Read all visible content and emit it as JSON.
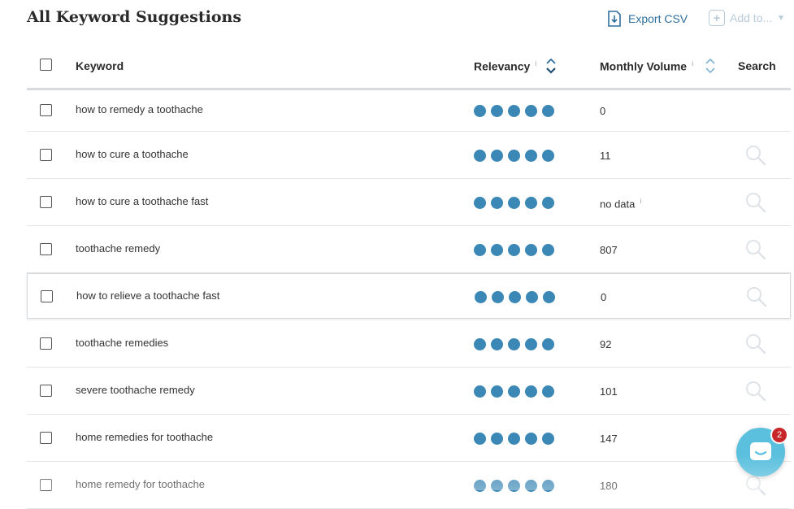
{
  "page": {
    "title": "All Keyword Suggestions",
    "export_label": "Export CSV",
    "add_to_label": "Add to..."
  },
  "table": {
    "headers": {
      "keyword": "Keyword",
      "relevancy": "Relevancy",
      "monthly_volume": "Monthly Volume",
      "search": "Search",
      "info": "i"
    },
    "rows": [
      {
        "keyword": "how to remedy a toothache",
        "relevancy": 5,
        "volume": "0"
      },
      {
        "keyword": "how to cure a toothache",
        "relevancy": 5,
        "volume": "11"
      },
      {
        "keyword": "how to cure a toothache fast",
        "relevancy": 5,
        "volume": "no data"
      },
      {
        "keyword": "toothache remedy",
        "relevancy": 5,
        "volume": "807"
      },
      {
        "keyword": "how to relieve a toothache fast",
        "relevancy": 5,
        "volume": "0"
      },
      {
        "keyword": "toothache remedies",
        "relevancy": 5,
        "volume": "92"
      },
      {
        "keyword": "severe toothache remedy",
        "relevancy": 5,
        "volume": "101"
      },
      {
        "keyword": "home remedies for toothache",
        "relevancy": 5,
        "volume": "147"
      },
      {
        "keyword": "home remedy for toothache",
        "relevancy": 5,
        "volume": "180"
      }
    ]
  },
  "chat": {
    "unread_count": "2"
  },
  "colors": {
    "accent": "#3b87b5",
    "link": "#2e6f9e",
    "disabled": "#b7cbd9",
    "chat": "#5bc0de",
    "badge": "#c9262c"
  }
}
